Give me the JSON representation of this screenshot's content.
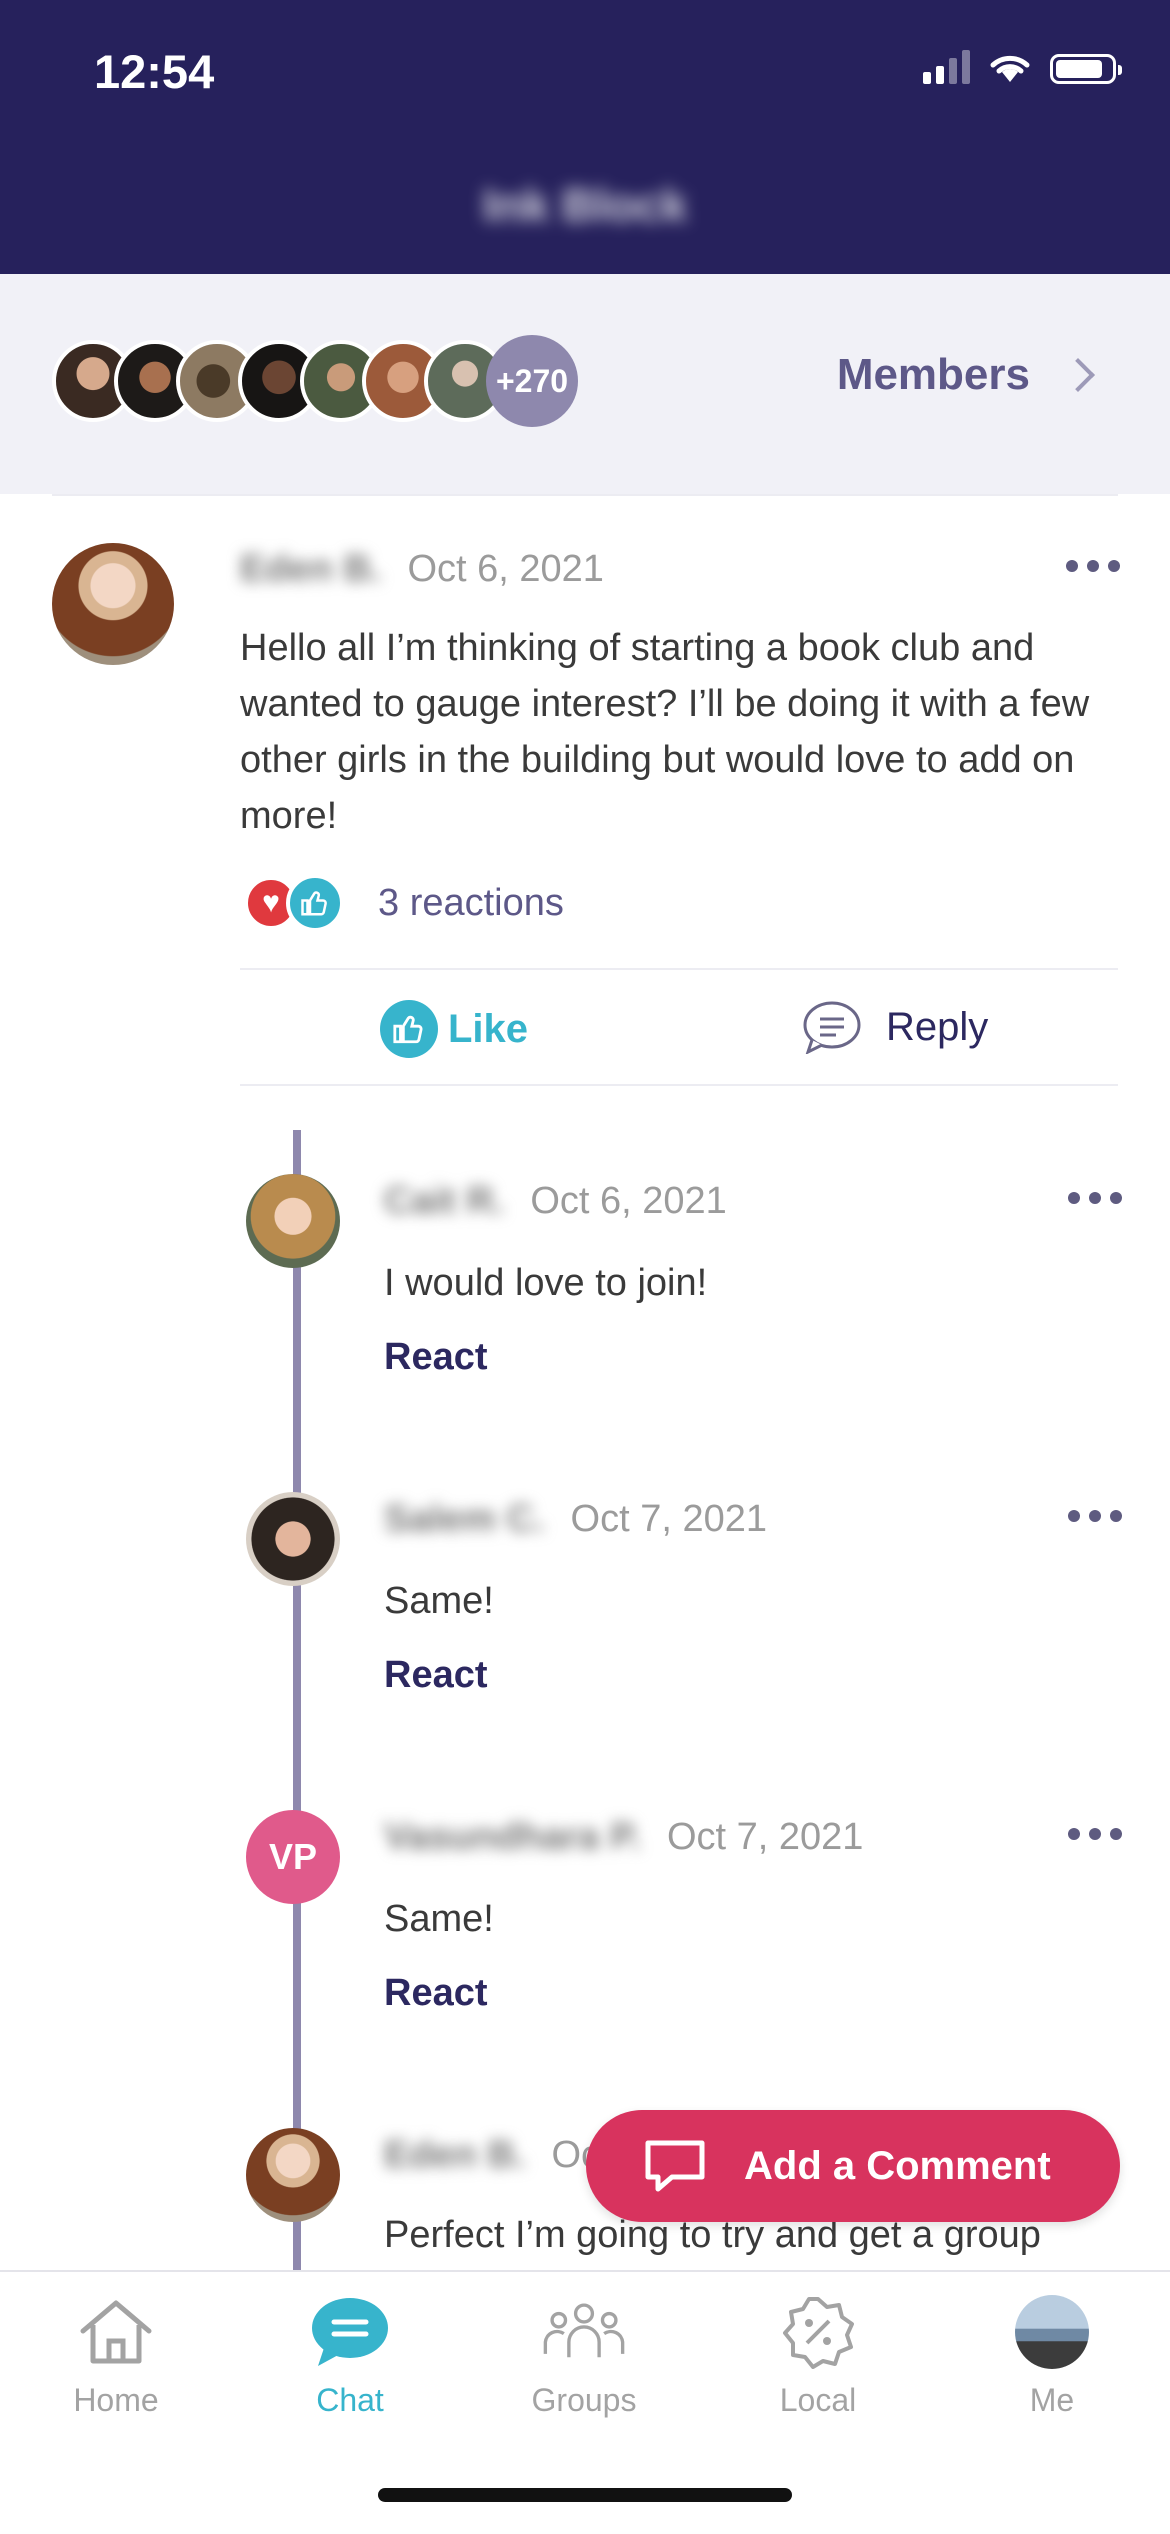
{
  "status_bar": {
    "time": "12:54"
  },
  "header": {
    "title": "Ink Block"
  },
  "members": {
    "extra_count": "+270",
    "label": "Members"
  },
  "post": {
    "author": "Eden B.",
    "date": "Oct 6, 2021",
    "text": "Hello all I’m thinking of starting a book club and wanted to gauge interest? I’ll be doing it with a few other girls in the building but would love to add on more!",
    "reactions_label": "3 reactions",
    "like_label": "Like",
    "reply_label": "Reply"
  },
  "replies": [
    {
      "author": "Cait R.",
      "date": "Oct 6, 2021",
      "text": "I would love to join!",
      "react_label": "React"
    },
    {
      "author": "Salem C.",
      "date": "Oct 7, 2021",
      "text": "Same!",
      "react_label": "React"
    },
    {
      "author": "Vasundhara P.",
      "initials": "VP",
      "date": "Oct 7, 2021",
      "text": "Same!",
      "react_label": "React"
    },
    {
      "author": "Eden B.",
      "date": "Oc",
      "text": "Perfect I’m going to try and get a group"
    }
  ],
  "add_comment_label": "Add a Comment",
  "tabs": [
    {
      "label": "Home",
      "icon": "home-icon"
    },
    {
      "label": "Chat",
      "icon": "chat-icon",
      "active": true
    },
    {
      "label": "Groups",
      "icon": "groups-icon"
    },
    {
      "label": "Local",
      "icon": "local-badge-icon"
    },
    {
      "label": "Me",
      "icon": "profile-avatar"
    }
  ],
  "colors": {
    "header": "#26215c",
    "accent": "#37b4cc",
    "cta": "#d8335e",
    "link": "#2c2860"
  }
}
